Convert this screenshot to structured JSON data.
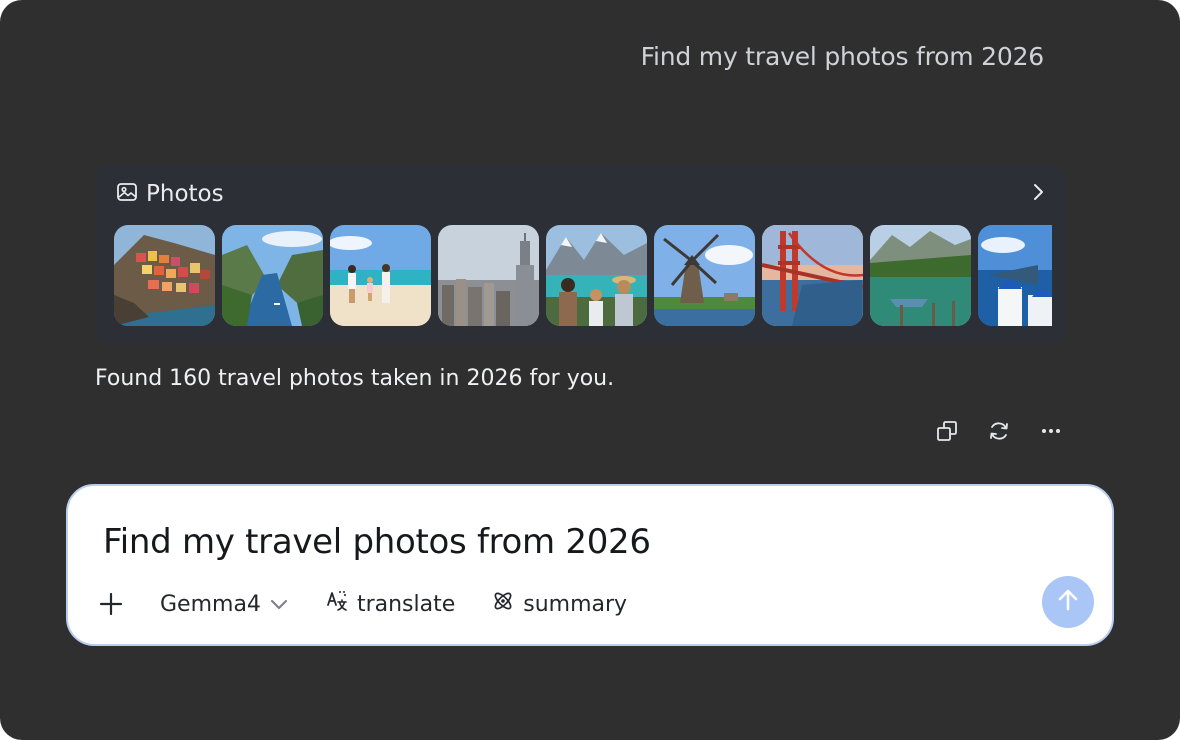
{
  "conversation": {
    "user_message": "Find my travel photos from 2026",
    "photos_card": {
      "title": "Photos",
      "icon": "image-icon",
      "more_icon": "chevron-right-icon",
      "thumbnails": [
        {
          "name": "cliffside-village"
        },
        {
          "name": "fjord-valley"
        },
        {
          "name": "family-beach"
        },
        {
          "name": "city-skyline"
        },
        {
          "name": "lake-mountains-family"
        },
        {
          "name": "windmill"
        },
        {
          "name": "red-suspension-bridge"
        },
        {
          "name": "boat-on-lake"
        },
        {
          "name": "blue-dome-coast"
        }
      ]
    },
    "assistant_message": "Found 160 travel photos taken in 2026 for you.",
    "actions": [
      "copy-icon",
      "regenerate-icon",
      "more-icon"
    ]
  },
  "composer": {
    "text": "Find my travel photos from 2026",
    "add_icon": "plus-icon",
    "model": "Gemma4",
    "model_icon": "chevron-down-icon",
    "tools": [
      {
        "label": "translate",
        "icon": "translate-icon"
      },
      {
        "label": "summary",
        "icon": "atom-icon"
      }
    ],
    "send_icon": "arrow-up-icon"
  },
  "colors": {
    "background": "#2f2f2f",
    "card": "#2c2f36",
    "send_button": "#a9c6f7",
    "input_border": "#b9cdf0"
  }
}
